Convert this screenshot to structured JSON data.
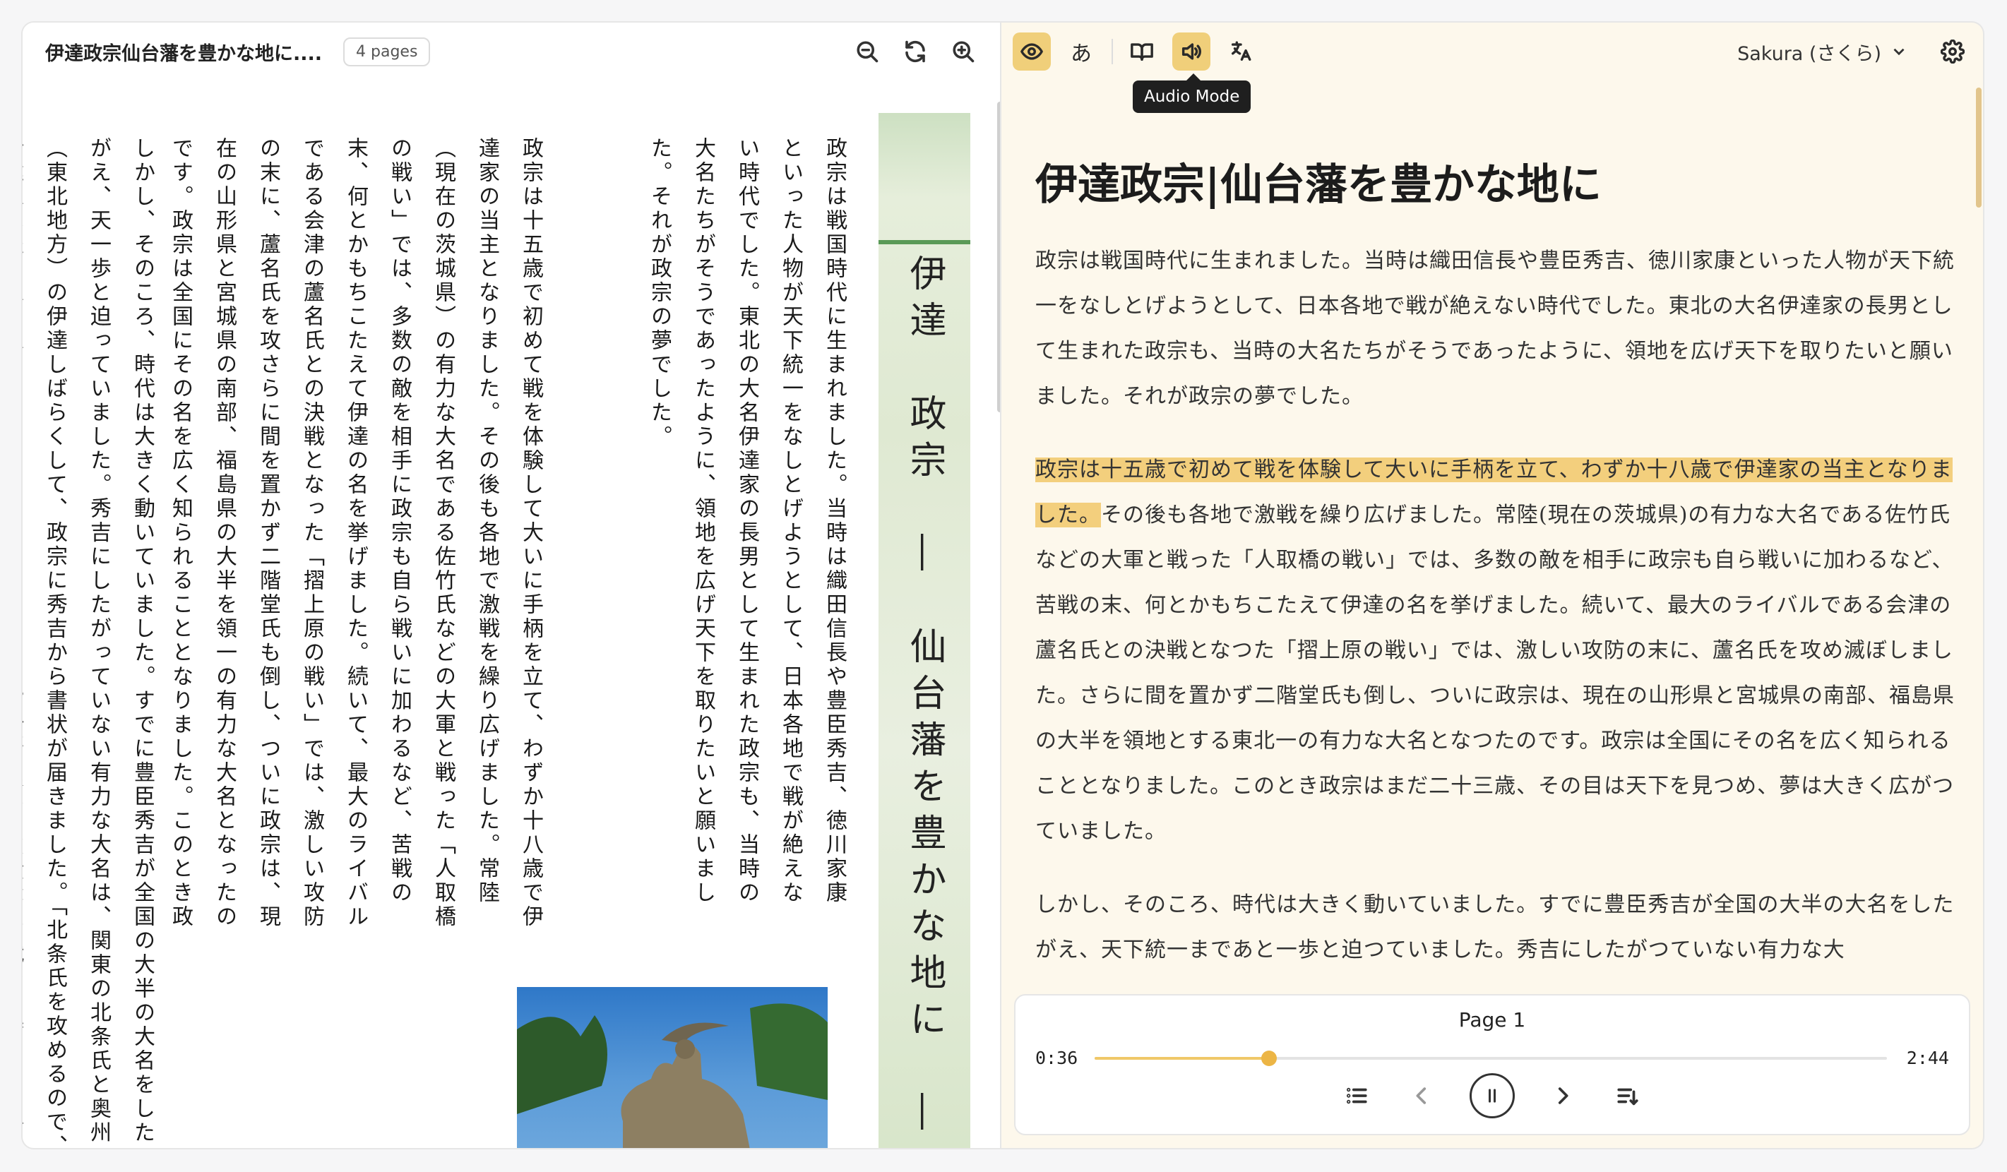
{
  "left": {
    "title": "伊達政宗仙台藩を豊かな地に....",
    "page_count": "4 pages",
    "banner_title": "伊達　政宗　―　仙台藩を豊かな地に　―",
    "columns": [
      "政宗は戦国時代に生まれました。当時は織田信長や豊臣秀吉、徳川家康といった人物が天下統一をなしとげようとして、日本各地で戦が絶えない時代でした。東北の大名伊達家の長男として生まれた政宗も、当時の大名たちがそうであったように、領地を広げ天下を取りたいと願いました。それが政宗の夢でした。",
      "政宗は十五歳で初めて戦を体験して大いに手柄を立て、わずか十八歳で伊達家の当主となりました。その後も各地で激戦を繰り広げました。常陸（現在の茨城県）の有力な大名である佐竹氏などの大軍と戦った「人取橋の戦い」では、多数の敵を相手に政宗も自ら戦いに加わるなど、苦戦の末、何とかもちこたえて伊達の名を挙げました。続いて、最大のライバルである会津の蘆名氏との決戦となった「摺上原の戦い」では、激しい攻防の末に、蘆名氏を攻さらに間を置かず二階堂氏も倒し、ついに政宗は、現在の山形県と宮城県の南部、福島県の大半を領一の有力な大名となったのです。政宗は全国にその名を広く知られることとなりました。このとき政三歳、その目は天下を見つめ、夢は大きく広がっていきました。",
      "しかし、そのころ、時代は大きく動いていました。すでに豊臣秀吉が全国の大半の大名をしたがえ、天一歩と迫っていました。秀吉にしたがっていない有力な大名は、関東の北条氏と奥州（東北地方）の伊達しばらくして、政宗に秀吉から書状が届きました。「北条氏を攻めるので、伊達家は豊臣家の家臣としように」とのことでした。（豊臣秀吉は強大だ、戦って勝てる相手であろうか。だが、ここで秀吉に"
    ]
  },
  "toolbar": {
    "tooltip": "Audio Mode",
    "kana_label": "あ",
    "voice": "Sakura (さくら)"
  },
  "reader": {
    "title": "伊達政宗|仙台藩を豊かな地に",
    "p1": "政宗は戦国時代に生まれました。当時は織田信長や豊臣秀吉、徳川家康といった人物が天下統一をなしとげようとして、日本各地で戦が絶えない時代でした。東北の大名伊達家の長男として生まれた政宗も、当時の大名たちがそうであったように、領地を広げ天下を取りたいと願いました。それが政宗の夢でした。",
    "p2_highlight": "政宗は十五歳で初めて戦を体験して大いに手柄を立て、わずか十八歳で伊達家の当主となりました。",
    "p2_rest": "その後も各地で激戦を繰り広げました。常陸(現在の茨城県)の有力な大名である佐竹氏などの大軍と戦った「人取橋の戦い」では、多数の敵を相手に政宗も自ら戦いに加わるなど、苦戦の末、何とかもちこたえて伊達の名を挙げました。続いて、最大のライバルである会津の蘆名氏との決戦となつた「摺上原の戦い」では、激しい攻防の末に、蘆名氏を攻め滅ぼしました。さらに間を置かず二階堂氏も倒し、ついに政宗は、現在の山形県と宮城県の南部、福島県の大半を領地とする東北一の有力な大名となつたのです。政宗は全国にその名を広く知られることとなりました。このとき政宗はまだ二十三歳、その目は天下を見つめ、夢は大きく広がつていました。",
    "p3": "しかし、そのころ、時代は大きく動いていました。すでに豊臣秀吉が全国の大半の大名をしたがえ、天下統一まであと一歩と迫つていました。秀吉にしたがつていない有力な大"
  },
  "player": {
    "page_label": "Page 1",
    "current_time": "0:36",
    "total_time": "2:44",
    "progress_fraction": 0.22
  },
  "colors": {
    "accent": "#f0cf7a",
    "highlight": "#f3cf7d",
    "reader_bg": "#fdf8ec"
  }
}
